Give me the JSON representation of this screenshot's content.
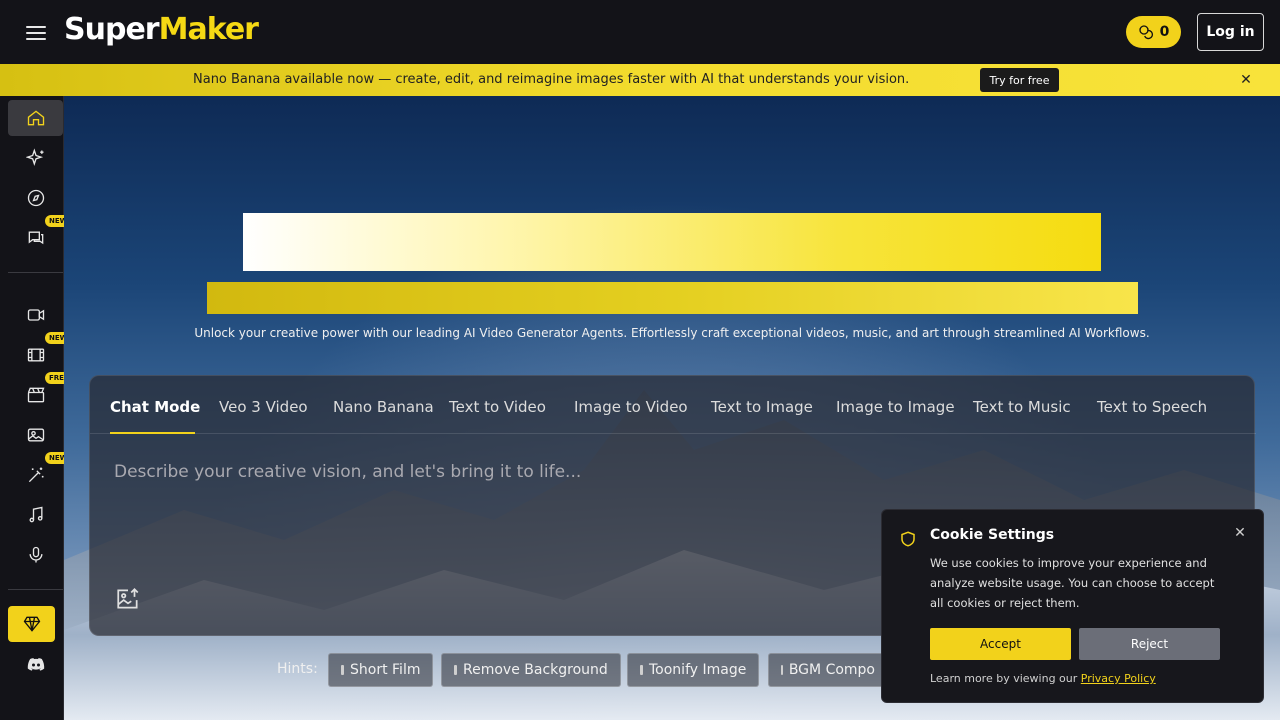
{
  "header": {
    "logo_part1": "Super",
    "logo_part2": "Maker",
    "credits": "0",
    "login_label": "Log in"
  },
  "banner": {
    "text": "Nano Banana available now — create, edit, and reimagine images faster with AI that understands your vision.",
    "cta": "Try for free",
    "close": "✕"
  },
  "sidebar": {
    "badges": {
      "chat": "NEW",
      "film": "NEW",
      "movie": "FREE",
      "magic": "NEW"
    }
  },
  "hero": {
    "subtitle": "Unlock your creative power with our leading AI Video Generator Agents. Effortlessly craft exceptional videos, music, and art through streamlined AI Workflows."
  },
  "tabs": [
    "Chat Mode",
    "Veo 3 Video",
    "Nano Banana",
    "Text to Video",
    "Image to Video",
    "Text to Image",
    "Image to Image",
    "Text to Music",
    "Text to Speech"
  ],
  "prompt_placeholder": "Describe your creative vision, and let's bring it to life...",
  "hints": {
    "label": "Hints:",
    "items": [
      "Short Film",
      "Remove Background",
      "Toonify Image",
      "BGM Compo"
    ]
  },
  "cookie": {
    "title": "Cookie Settings",
    "close": "✕",
    "text": "We use cookies to improve your experience and analyze website usage. You can choose to accept all cookies or reject them.",
    "accept": "Accept",
    "reject": "Reject",
    "foot": "Learn more by viewing our ",
    "policy": "Privacy Policy"
  },
  "colors": {
    "accent": "#f2d21b",
    "bg": "#131318"
  }
}
